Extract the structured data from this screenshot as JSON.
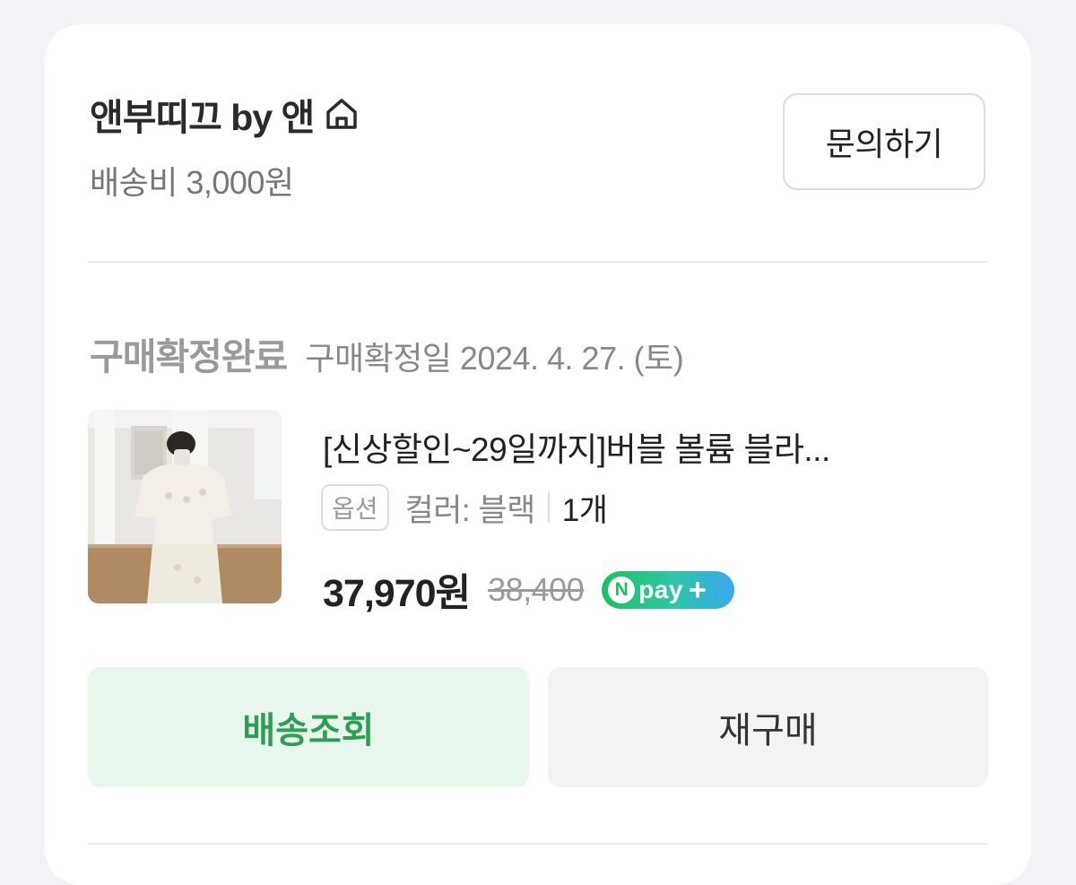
{
  "seller": {
    "name": "앤부띠끄 by 앤",
    "shipping_fee": "배송비 3,000원",
    "inquiry_label": "문의하기"
  },
  "order": {
    "status": "구매확정완료",
    "confirm_date": "구매확정일 2024. 4. 27. (토)"
  },
  "product": {
    "title": "[신상할인~29일까지]버블 볼륨 블라...",
    "option_badge": "옵션",
    "option_value": "컬러: 블랙",
    "quantity": "1개",
    "sale_price": "37,970원",
    "original_price": "38,400",
    "npay": {
      "n": "N",
      "text": "pay",
      "plus": "+"
    }
  },
  "actions": {
    "track_label": "배송조회",
    "rebuy_label": "재구매"
  },
  "colors": {
    "accent_green": "#2e9e55",
    "track_bg": "#e8f6ed",
    "background": "#f1f3f6"
  },
  "icons": {
    "home": "home-icon",
    "npay": "npay-plus-badge"
  }
}
